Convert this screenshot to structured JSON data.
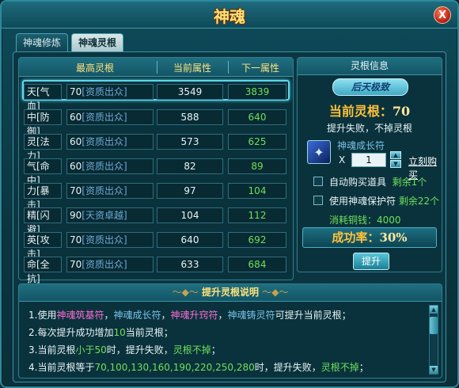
{
  "window": {
    "title": "神魂",
    "close_label": "X"
  },
  "tabs": [
    {
      "label": "神魂修炼"
    },
    {
      "label": "神魂灵根"
    }
  ],
  "table": {
    "headers": {
      "max": "最高灵根",
      "current": "当前属性",
      "next": "下一属性"
    },
    "rows": [
      {
        "attr": "天[气血]",
        "max": "70",
        "quality": "[资质出众]",
        "current": "3549",
        "next": "3839"
      },
      {
        "attr": "中[防御]",
        "max": "60",
        "quality": "[资质出众]",
        "current": "588",
        "next": "640"
      },
      {
        "attr": "灵[法力]",
        "max": "60",
        "quality": "[资质出众]",
        "current": "573",
        "next": "625"
      },
      {
        "attr": "气[命中]",
        "max": "60",
        "quality": "[资质出众]",
        "current": "82",
        "next": "89"
      },
      {
        "attr": "力[暴击]",
        "max": "70",
        "quality": "[资质出众]",
        "current": "97",
        "next": "104"
      },
      {
        "attr": "精[闪避]",
        "max": "90",
        "quality": "[天资卓越]",
        "current": "104",
        "next": "112"
      },
      {
        "attr": "英[攻击]",
        "max": "70",
        "quality": "[资质出众]",
        "current": "640",
        "next": "692"
      },
      {
        "attr": "命[全抗]",
        "max": "70",
        "quality": "[资质出众]",
        "current": "633",
        "next": "684"
      }
    ]
  },
  "info": {
    "header": "灵根信息",
    "rank_banner": "后天极致",
    "current_root_label": "当前灵根：",
    "current_root_value": "70",
    "fail_note": "提升失败，不掉灵根",
    "item_name": "神魂成长符",
    "x_label": "X",
    "quantity": "1",
    "buy_now": "立刻购买",
    "auto_buy_label": "自动购买道具",
    "auto_buy_remain": "剩余1个",
    "protect_label": "使用神魂保护符",
    "protect_remain": "剩余22个",
    "consume": "消耗铜钱：4000",
    "success_label": "成功率：",
    "success_value": "30%",
    "upgrade_button": "提升"
  },
  "description": {
    "title": "提升灵根说明",
    "line1": {
      "prefix": "1.使用",
      "item_a": "神魂筑基符",
      "sep1": "，",
      "item_b": "神魂成长符",
      "sep2": "，",
      "item_c": "神魂升窍符",
      "sep3": "，",
      "item_d": "神魂铸灵符",
      "suffix": "可提升当前灵根；"
    },
    "line2": {
      "prefix": "2.每次提升成功增加",
      "value": "10",
      "suffix": "当前灵根；"
    },
    "line3": {
      "prefix": "3.当前灵根",
      "cond": "小于50",
      "mid": "时，提升失败，",
      "result": "灵根不掉",
      "suffix": "；"
    },
    "line4": {
      "prefix": "4.当前灵根等于",
      "values": "70,100,130,160,190,220,250,280",
      "mid": "时，提升失败，",
      "result": "灵根不掉",
      "suffix": "；"
    }
  },
  "colors": {
    "title_gold": "#ffe27a",
    "green_value": "#6ee05a",
    "quality_blue": "#6fa9d6",
    "selection_cyan": "#5bd7ee",
    "pink_item": "#ff6cd2"
  }
}
